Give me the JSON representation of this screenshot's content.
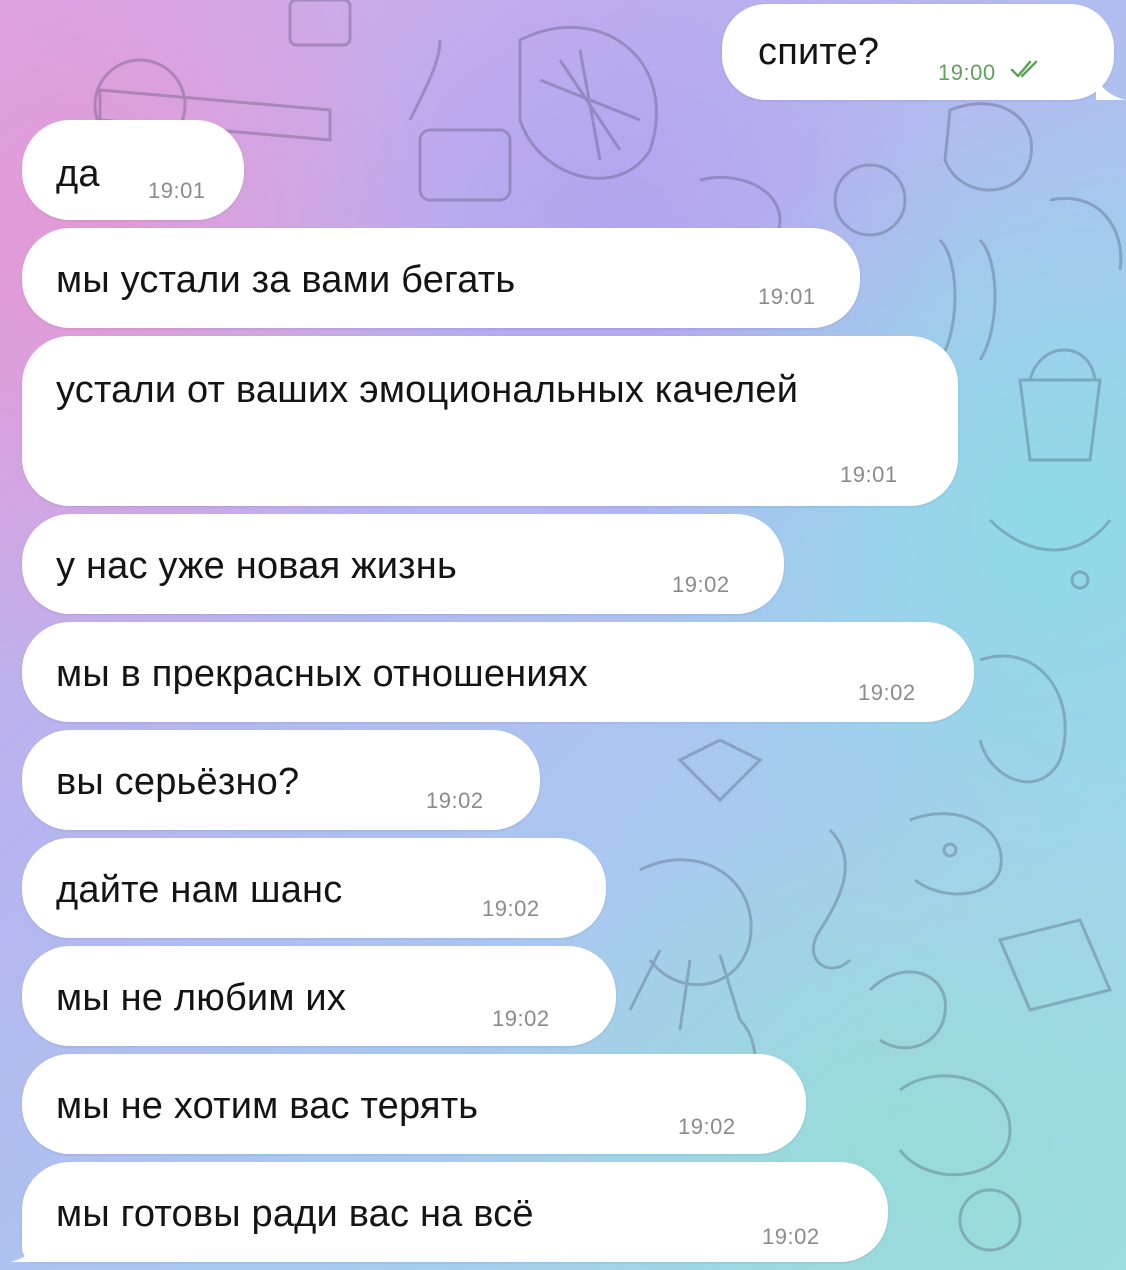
{
  "chat": {
    "outgoing": [
      {
        "text": "спите?",
        "time": "19:00",
        "status_icon": "double-check-icon"
      }
    ],
    "incoming": [
      {
        "text": "да",
        "time": "19:01"
      },
      {
        "text": "мы устали за вами бегать",
        "time": "19:01"
      },
      {
        "text": "устали от ваших эмоциональных качелей",
        "time": "19:01"
      },
      {
        "text": "у нас уже новая жизнь",
        "time": "19:02"
      },
      {
        "text": "мы в прекрасных отношениях",
        "time": "19:02"
      },
      {
        "text": "вы серьёзно?",
        "time": "19:02"
      },
      {
        "text": "дайте нам шанс",
        "time": "19:02"
      },
      {
        "text": "мы не любим их",
        "time": "19:02"
      },
      {
        "text": "мы не хотим вас терять",
        "time": "19:02"
      },
      {
        "text": "мы готовы ради вас на всё",
        "time": "19:02"
      }
    ]
  },
  "colors": {
    "bubble": "#ffffff",
    "text": "#141414",
    "time_incoming": "#8a8a8f",
    "time_outgoing": "#5fa35a",
    "background_pink": "#d9a6e6",
    "background_cyan": "#9fdde3"
  }
}
